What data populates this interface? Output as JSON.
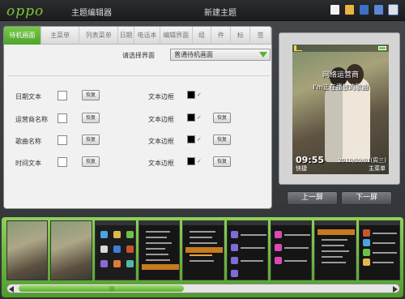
{
  "titlebar": {
    "logo": "oppo",
    "app_title": "主题编辑器",
    "doc_title": "新建主题",
    "icons": [
      "new-file-icon",
      "open-folder-icon",
      "save-icon",
      "save-as-icon",
      "export-icon"
    ]
  },
  "tabs": [
    "待机画面",
    "主菜单",
    "列表菜单",
    "日期",
    "电话本",
    "编辑界面",
    "组",
    "件",
    "标",
    "签"
  ],
  "active_tab": 0,
  "select": {
    "label": "请选择界面",
    "value": "普通待机画面"
  },
  "rows": [
    {
      "label": "日期文本",
      "restore": "恢复",
      "right_label": "文本边框",
      "right_restore": ""
    },
    {
      "label": "运营商名称",
      "restore": "恢复",
      "right_label": "文本边框",
      "right_restore": "恢复"
    },
    {
      "label": "歌曲名称",
      "restore": "恢复",
      "right_label": "文本边框",
      "right_restore": "恢复"
    },
    {
      "label": "时间文本",
      "restore": "恢复",
      "right_label": "文本边框",
      "right_restore": "恢复"
    }
  ],
  "preview": {
    "line1": "网络运营商",
    "line2": "I'm正在播放的歌曲",
    "time": "09:55",
    "date": "2010/09/01(周三)",
    "left_soft": "快捷",
    "right_soft": "主菜单"
  },
  "nav": {
    "prev": "上一屏",
    "next": "下一屏"
  },
  "colors": {
    "accent_green": "#5bb033",
    "strip_green": "#6fbf3f",
    "menu_highlight": "#c57b1e"
  },
  "scrollbar": {
    "position_fraction": 0.42
  }
}
